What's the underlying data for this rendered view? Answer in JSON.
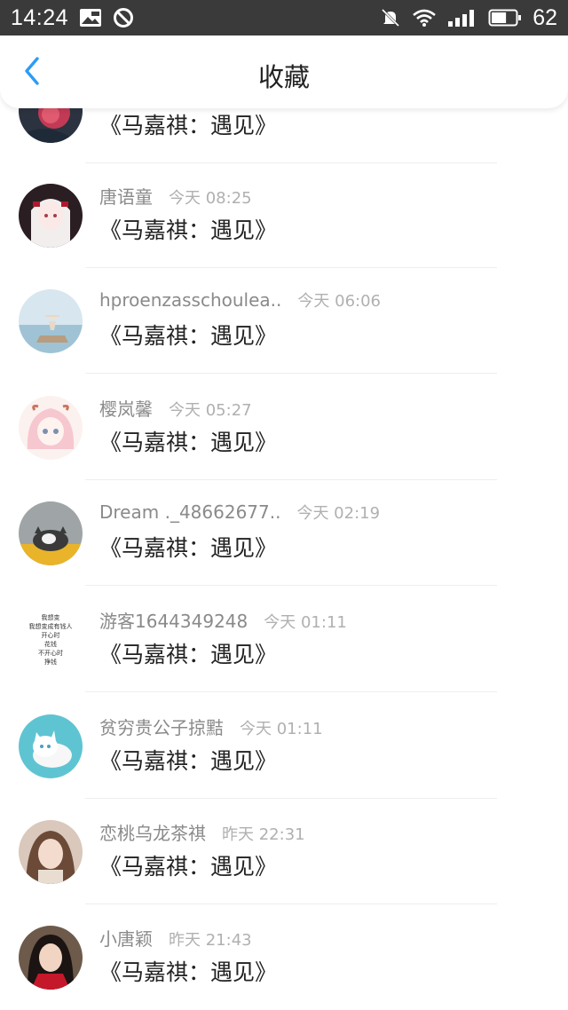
{
  "status_bar": {
    "time": "14:24",
    "battery_level": "62",
    "left_icons": [
      "image-icon",
      "blocked-icon"
    ],
    "right_icons": [
      "mute-icon",
      "wifi-icon",
      "signal-icon",
      "battery-icon"
    ]
  },
  "nav": {
    "title": "收藏",
    "back_icon": "chevron-left-icon",
    "accent_color": "#2d9cf5"
  },
  "items": [
    {
      "username": "",
      "time": "",
      "content": "《马嘉祺：遇见》",
      "avatar": "rose"
    },
    {
      "username": "唐语童",
      "time": "今天 08:25",
      "content": "《马嘉祺：遇见》",
      "avatar": "anime-girl-white"
    },
    {
      "username": "hproenzasschoulea..",
      "time": "今天 06:06",
      "content": "《马嘉祺：遇见》",
      "avatar": "seaside-yoga"
    },
    {
      "username": "樱岚馨",
      "time": "今天 05:27",
      "content": "《马嘉祺：遇见》",
      "avatar": "anime-girl-pink"
    },
    {
      "username": "Dream ._48662677..",
      "time": "今天 02:19",
      "content": "《马嘉祺：遇见》",
      "avatar": "cat-yellow"
    },
    {
      "username": "游客1644349248",
      "time": "今天 01:11",
      "content": "《马嘉祺：遇见》",
      "avatar": "text-avatar",
      "avatar_lines": [
        "我想变",
        "我想变成有钱人",
        "开心时",
        "花钱",
        "不开心时",
        "挣钱"
      ]
    },
    {
      "username": "贫穷贵公子掠黠",
      "time": "今天 01:11",
      "content": "《马嘉祺：遇见》",
      "avatar": "white-cat"
    },
    {
      "username": "恋桃乌龙茶祺",
      "time": "昨天 22:31",
      "content": "《马嘉祺：遇见》",
      "avatar": "girl-portrait"
    },
    {
      "username": "小唐颖",
      "time": "昨天 21:43",
      "content": "《马嘉祺：遇见》",
      "avatar": "girl-red"
    }
  ]
}
